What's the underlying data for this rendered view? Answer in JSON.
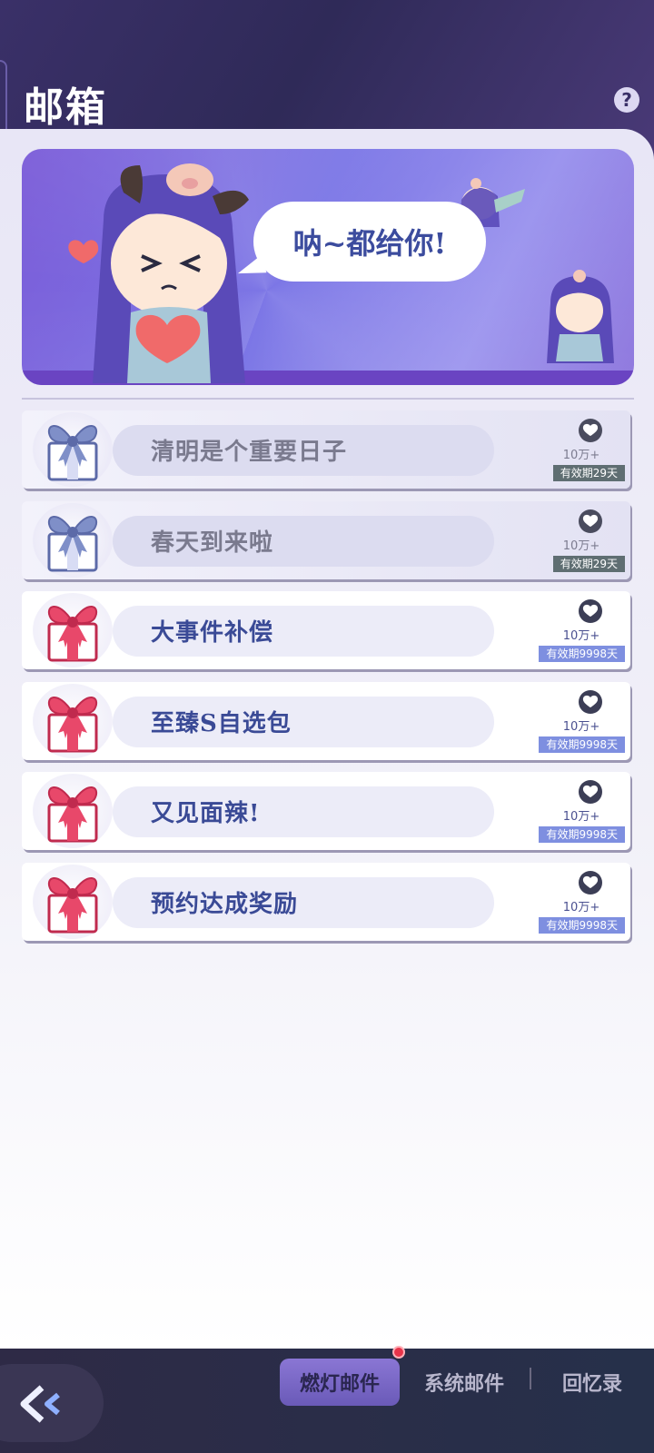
{
  "header": {
    "title": "邮箱",
    "help_icon": "question-circle-icon",
    "help_glyph": "?"
  },
  "banner": {
    "speech": "呐~都给你!"
  },
  "mails": [
    {
      "subject": "清明是个重要日子",
      "count": "10万+",
      "expiry": "有效期29天",
      "state": "read",
      "icon": "gift-box-icon"
    },
    {
      "subject": "春天到来啦",
      "count": "10万+",
      "expiry": "有效期29天",
      "state": "read",
      "icon": "gift-box-icon"
    },
    {
      "subject": "大事件补偿",
      "count": "10万+",
      "expiry": "有效期9998天",
      "state": "unread",
      "icon": "gift-box-icon"
    },
    {
      "subject": "至臻S自选包",
      "count": "10万+",
      "expiry": "有效期9998天",
      "state": "unread",
      "icon": "gift-box-icon"
    },
    {
      "subject": "又见面辣!",
      "count": "10万+",
      "expiry": "有效期9998天",
      "state": "unread",
      "icon": "gift-box-icon"
    },
    {
      "subject": "预约达成奖励",
      "count": "10万+",
      "expiry": "有效期9998天",
      "state": "unread",
      "icon": "gift-box-icon"
    }
  ],
  "bottom_nav": {
    "back_icon": "double-chevron-left-icon",
    "tabs": [
      {
        "label": "燃灯邮件",
        "active": true
      },
      {
        "label": "系统邮件",
        "active": false
      },
      {
        "label": "回忆录",
        "active": false
      }
    ]
  },
  "colors": {
    "header_bg": "#2f2a58",
    "accent_purple": "#7b5cd8",
    "unread_text": "#3a4a96",
    "read_text": "#7a7a8e",
    "expiry_read": "#5f6e72",
    "expiry_unread": "#7e8fe0",
    "notification_dot": "#e8344a"
  }
}
